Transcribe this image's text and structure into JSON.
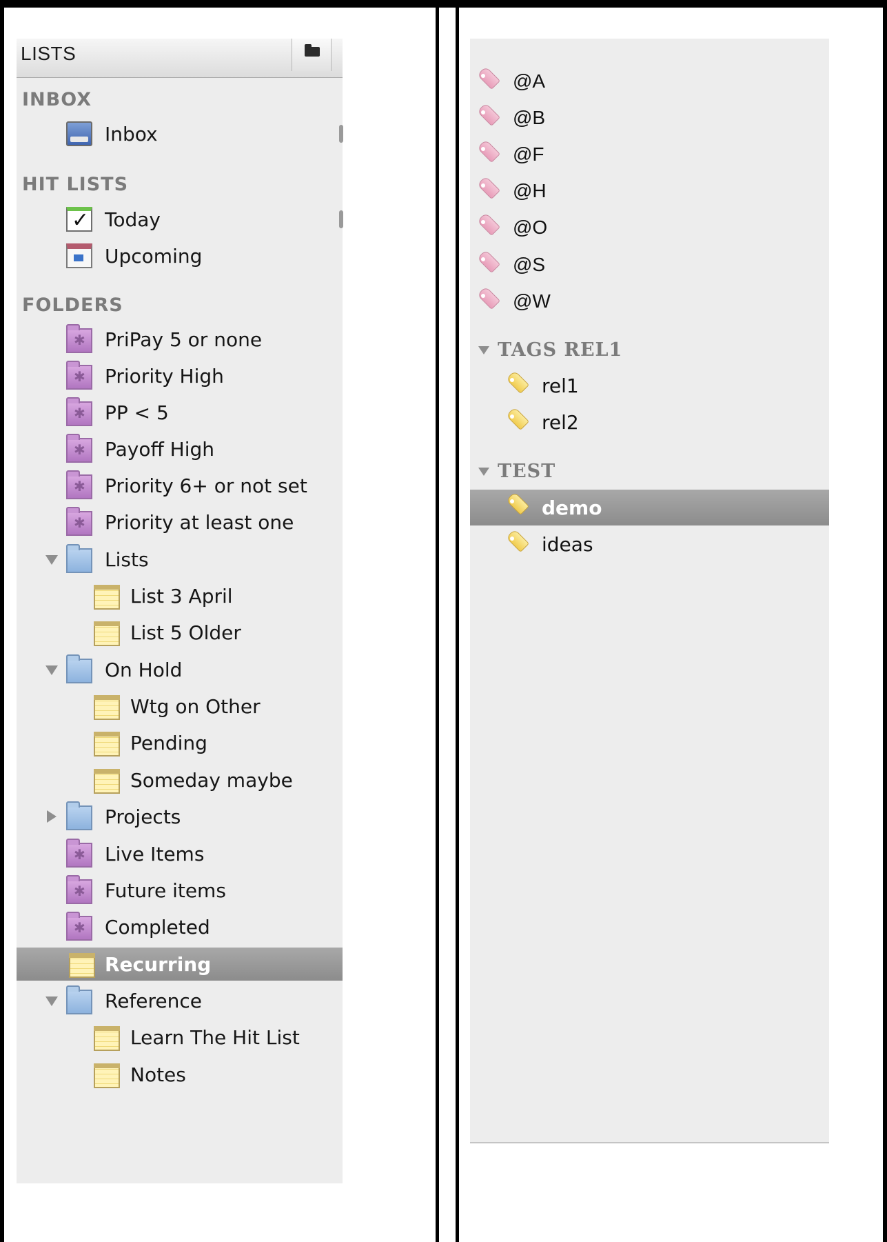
{
  "lists_panel": {
    "header_title": "LISTS",
    "sections": {
      "inbox": "INBOX",
      "hit_lists": "HIT LISTS",
      "folders": "FOLDERS"
    },
    "inbox_items": [
      {
        "label": "Inbox",
        "icon": "inbox-tray-icon"
      }
    ],
    "hit_list_items": [
      {
        "label": "Today",
        "icon": "checkbox-icon"
      },
      {
        "label": "Upcoming",
        "icon": "calendar-icon"
      }
    ],
    "folder_items": [
      {
        "label": "PriPay 5 or none",
        "icon": "smart-folder-icon"
      },
      {
        "label": "Priority High",
        "icon": "smart-folder-icon"
      },
      {
        "label": "PP < 5",
        "icon": "smart-folder-icon"
      },
      {
        "label": "Payoff High",
        "icon": "smart-folder-icon"
      },
      {
        "label": "Priority 6+ or not set",
        "icon": "smart-folder-icon"
      },
      {
        "label": "Priority at least one",
        "icon": "smart-folder-icon"
      },
      {
        "label": "Lists",
        "icon": "folder-icon",
        "expanded": true
      },
      {
        "label": "List 3 April",
        "icon": "list-icon"
      },
      {
        "label": "List 5 Older",
        "icon": "list-icon"
      },
      {
        "label": "On Hold",
        "icon": "folder-icon",
        "expanded": true
      },
      {
        "label": "Wtg on Other",
        "icon": "list-icon"
      },
      {
        "label": "Pending",
        "icon": "list-icon"
      },
      {
        "label": "Someday maybe",
        "icon": "list-icon"
      },
      {
        "label": "Projects",
        "icon": "folder-icon",
        "expanded": false
      },
      {
        "label": "Live Items",
        "icon": "smart-folder-icon"
      },
      {
        "label": "Future items",
        "icon": "smart-folder-icon"
      },
      {
        "label": "Completed",
        "icon": "smart-folder-icon"
      },
      {
        "label": "Recurring",
        "icon": "list-icon",
        "selected": true
      },
      {
        "label": "Reference",
        "icon": "folder-icon",
        "expanded": true
      },
      {
        "label": "Learn The Hit List",
        "icon": "list-icon"
      },
      {
        "label": "Notes",
        "icon": "list-icon"
      }
    ]
  },
  "tags_panel": {
    "context_tags": [
      "@A",
      "@B",
      "@F",
      "@H",
      "@O",
      "@S",
      "@W"
    ],
    "groups": [
      {
        "label": "TAGS REL1",
        "tags": [
          "rel1",
          "rel2"
        ]
      },
      {
        "label": "TEST",
        "tags": [
          "demo",
          "ideas"
        ],
        "selected": "demo"
      }
    ]
  },
  "colors": {
    "panel_bg": "#ededed",
    "selection": "#9b9b9b",
    "smart_folder": "#c18bcf",
    "folder": "#9fc2e7",
    "list": "#fbeaa0",
    "tag_pink": "#eeb1c8",
    "tag_yellow": "#f4d66a"
  }
}
